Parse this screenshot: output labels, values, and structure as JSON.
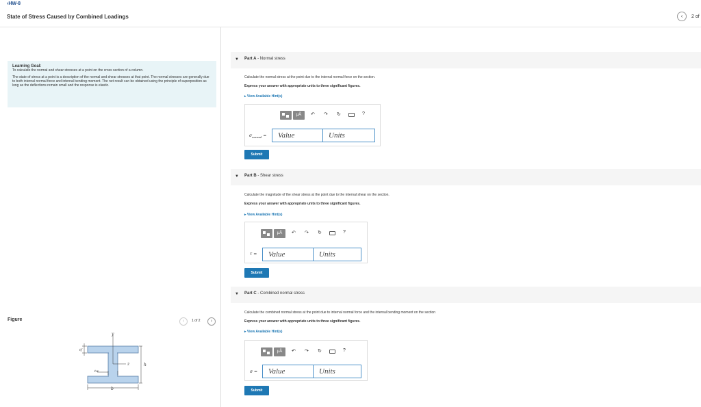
{
  "header": {
    "back_link": "‹HW-8",
    "title": "State of Stress Caused by Combined Loadings",
    "pager_text": "2 of"
  },
  "learning_goal": {
    "title": "Learning Goal:",
    "text": "To calculate the normal and shear stresses at a point on the cross section of a column.",
    "paragraph": "The state of stress at a point is a description of the normal and shear stresses at that point. The normal stresses are generally due to both internal normal force and internal bending moment. The net result can be obtained using the principle of superposition as long as the deflections remain small and the response is elastic."
  },
  "figure": {
    "label": "Figure",
    "pager": "1 of 2",
    "labels": {
      "y": "y",
      "z": "z",
      "h": "h",
      "tf": "tf",
      "tw": "tw",
      "b": "b"
    },
    "fill_color": "#b9d3ec"
  },
  "parts": [
    {
      "prefix": "Part A",
      "title": "Normal stress",
      "question": "Calculate the normal stress at the point due to the internal normal force on the section.",
      "instructions": "Express your answer with appropriate units to three significant figures.",
      "hint": "View Available Hint(s)",
      "var_symbol": "σ",
      "var_sub": "normal",
      "var_eq": "=",
      "value_placeholder": "Value",
      "units_placeholder": "Units",
      "submit": "Submit"
    },
    {
      "prefix": "Part B",
      "title": "Shear stress",
      "question": "Calculate the magnitude of the shear stress at the point due to the internal shear on the section.",
      "instructions": "Express your answer with appropriate units to three significant figures.",
      "hint": "View Available Hint(s)",
      "var_symbol": "τ",
      "var_sub": "",
      "var_eq": "=",
      "value_placeholder": "Value",
      "units_placeholder": "Units",
      "submit": "Submit"
    },
    {
      "prefix": "Part C",
      "title": "Combined normal stress",
      "question": "Calculate the combined normal stress at the point due to internal normal force and the internal bending moment on the section",
      "instructions": "Express your answer with appropriate units to three significant figures.",
      "hint": "View Available Hint(s)",
      "var_symbol": "σ",
      "var_sub": "",
      "var_eq": "=",
      "value_placeholder": "Value",
      "units_placeholder": "Units",
      "submit": "Submit"
    }
  ],
  "toolbar": {
    "mu_label": "μÅ",
    "help_label": "?",
    "icons": [
      "templates-icon",
      "units-icon",
      "undo-icon",
      "redo-icon",
      "reset-icon",
      "keyboard-icon",
      "help-icon"
    ]
  },
  "colors": {
    "accent": "#1e78b4",
    "goal_bg": "#e8f4f7",
    "part_header_bg": "#f5f5f5",
    "field_border": "#4a90c8"
  }
}
